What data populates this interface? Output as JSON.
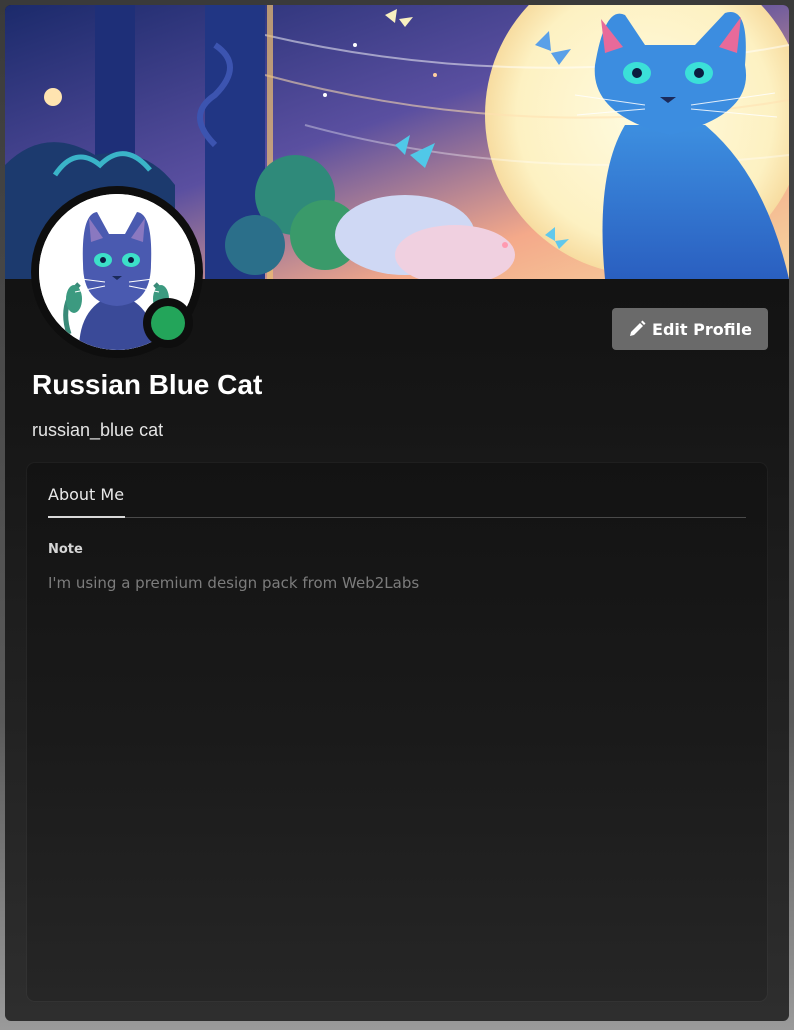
{
  "profile": {
    "display_name": "Russian Blue Cat",
    "username": "russian_blue cat",
    "status": "online",
    "status_color": "#23a55a"
  },
  "toolbar": {
    "edit_label": "Edit Profile",
    "edit_icon": "pencil-icon"
  },
  "tabs": [
    {
      "label": "About Me",
      "active": true
    }
  ],
  "about": {
    "note_heading": "Note",
    "note_text": "I'm using a premium design pack from Web2Labs"
  },
  "colors": {
    "button_bg": "#6a6a6a",
    "card_bg": "#0c0c0c",
    "status_online": "#23a55a"
  }
}
